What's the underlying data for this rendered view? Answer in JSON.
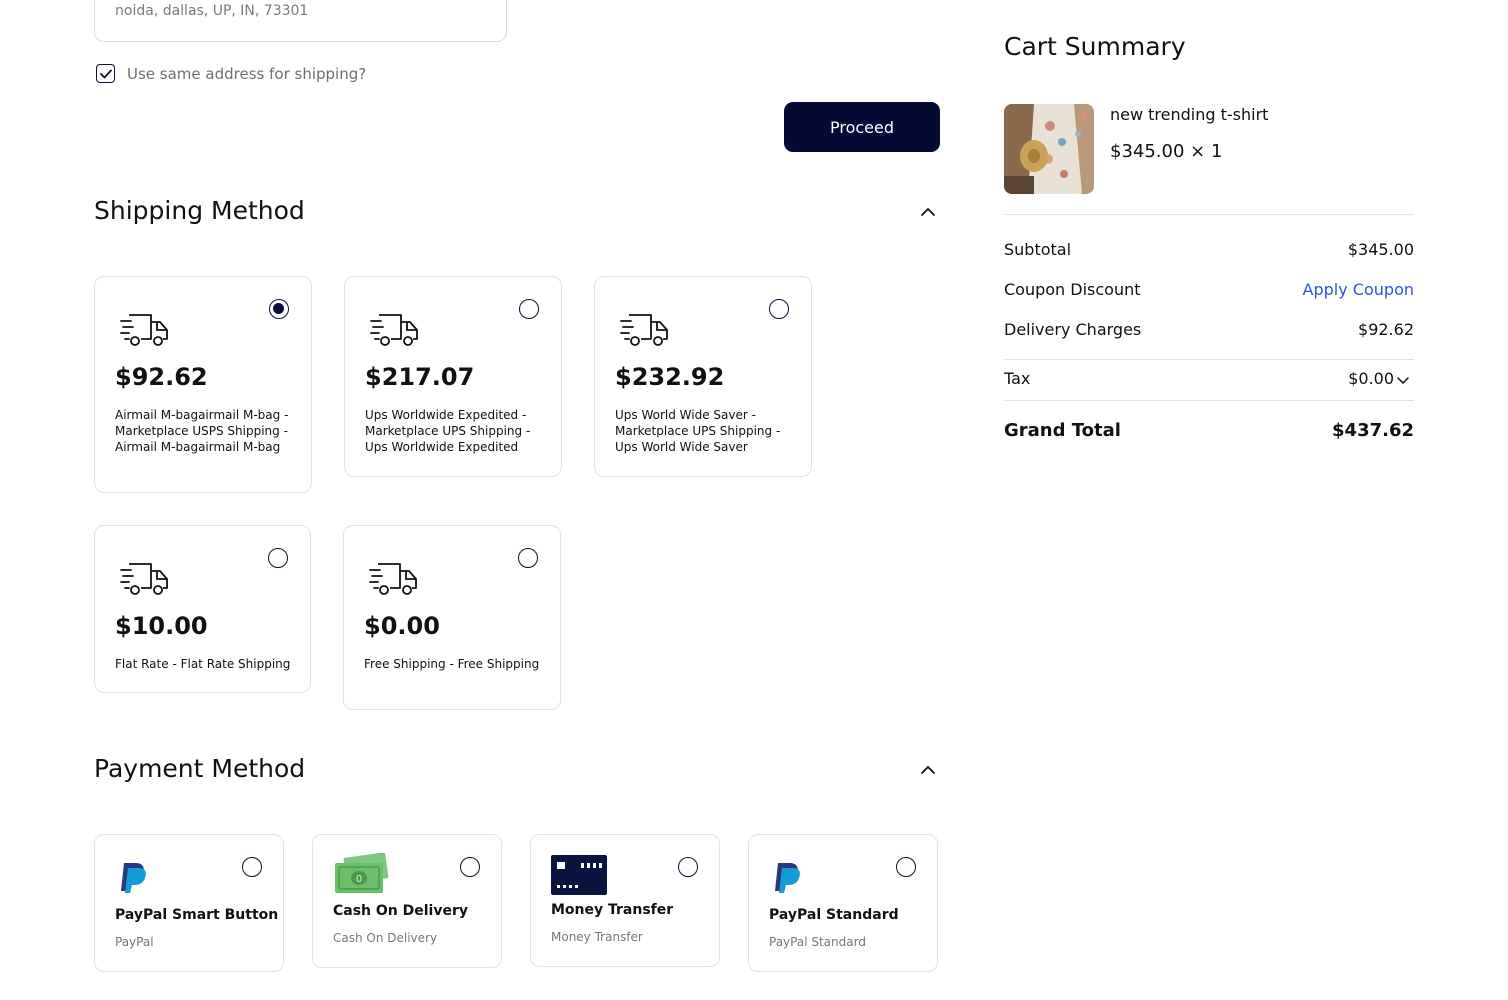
{
  "address": {
    "value": "noida, dallas, UP, IN, 73301"
  },
  "same_address": {
    "label": "Use same address for shipping?",
    "checked": true
  },
  "proceed_label": "Proceed",
  "shipping": {
    "title": "Shipping Method",
    "options": [
      {
        "price": "$92.62",
        "description": "Airmail M-bagairmail M-bag - Marketplace USPS Shipping - Airmail M-bagairmail M-bag",
        "selected": true
      },
      {
        "price": "$217.07",
        "description": "Ups Worldwide Expedited - Marketplace UPS Shipping - Ups Worldwide Expedited",
        "selected": false
      },
      {
        "price": "$232.92",
        "description": "Ups World Wide Saver - Marketplace UPS Shipping - Ups World Wide Saver",
        "selected": false
      },
      {
        "price": "$10.00",
        "description": "Flat Rate - Flat Rate Shipping",
        "selected": false
      },
      {
        "price": "$0.00",
        "description": "Free Shipping - Free Shipping",
        "selected": false
      }
    ]
  },
  "payment": {
    "title": "Payment Method",
    "options": [
      {
        "name": "PayPal Smart Button",
        "sub": "PayPal",
        "icon": "paypal-icon"
      },
      {
        "name": "Cash On Delivery",
        "sub": "Cash On Delivery",
        "icon": "cash-icon"
      },
      {
        "name": "Money Transfer",
        "sub": "Money Transfer",
        "icon": "card-icon"
      },
      {
        "name": "PayPal Standard",
        "sub": "PayPal Standard",
        "icon": "paypal-icon"
      }
    ]
  },
  "cart": {
    "title": "Cart Summary",
    "product": {
      "name": "new trending t-shirt",
      "price_qty": "$345.00 × 1"
    },
    "subtotal_label": "Subtotal",
    "subtotal_value": "$345.00",
    "coupon_label": "Coupon Discount",
    "coupon_link": "Apply Coupon",
    "delivery_label": "Delivery Charges",
    "delivery_value": "$92.62",
    "tax_label": "Tax",
    "tax_value": "$0.00",
    "grand_label": "Grand Total",
    "grand_value": "$437.62"
  },
  "colors": {
    "primary": "#050a35",
    "link": "#2b57d9",
    "border": "#e2e2e2"
  }
}
